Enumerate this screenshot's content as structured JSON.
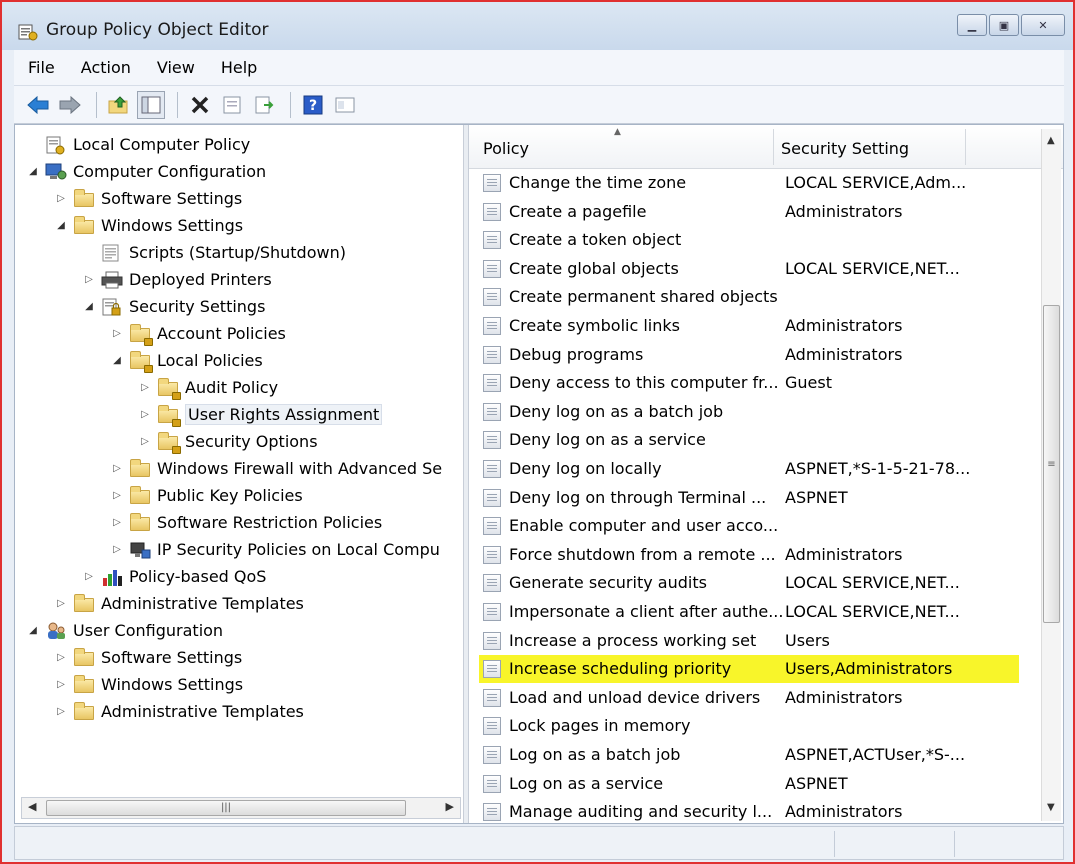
{
  "window": {
    "title": "Group Policy Object Editor"
  },
  "menu": [
    "File",
    "Action",
    "View",
    "Help"
  ],
  "toolbar": [
    "back-icon",
    "forward-icon",
    "up-folder-icon",
    "show-hide-tree-icon",
    "delete-icon",
    "properties-icon",
    "export-list-icon",
    "help-icon",
    "console-icon"
  ],
  "tree": [
    {
      "label": "Local Computer Policy",
      "depth": 0,
      "toggle": "",
      "icon": "policy"
    },
    {
      "label": "Computer Configuration",
      "depth": 0,
      "toggle": "open",
      "icon": "computer"
    },
    {
      "label": "Software Settings",
      "depth": 1,
      "toggle": "closed",
      "icon": "folder"
    },
    {
      "label": "Windows Settings",
      "depth": 1,
      "toggle": "open",
      "icon": "folder"
    },
    {
      "label": "Scripts (Startup/Shutdown)",
      "depth": 2,
      "toggle": "",
      "icon": "script"
    },
    {
      "label": "Deployed Printers",
      "depth": 2,
      "toggle": "closed",
      "icon": "printer"
    },
    {
      "label": "Security Settings",
      "depth": 2,
      "toggle": "open",
      "icon": "security"
    },
    {
      "label": "Account Policies",
      "depth": 3,
      "toggle": "closed",
      "icon": "folder-lock"
    },
    {
      "label": "Local Policies",
      "depth": 3,
      "toggle": "open",
      "icon": "folder-lock"
    },
    {
      "label": "Audit Policy",
      "depth": 4,
      "toggle": "closed",
      "icon": "folder-lock"
    },
    {
      "label": "User Rights Assignment",
      "depth": 4,
      "toggle": "closed",
      "icon": "folder-lock",
      "selected": true
    },
    {
      "label": "Security Options",
      "depth": 4,
      "toggle": "closed",
      "icon": "folder-lock"
    },
    {
      "label": "Windows Firewall with Advanced Se",
      "depth": 3,
      "toggle": "closed",
      "icon": "folder"
    },
    {
      "label": "Public Key Policies",
      "depth": 3,
      "toggle": "closed",
      "icon": "folder"
    },
    {
      "label": "Software Restriction Policies",
      "depth": 3,
      "toggle": "closed",
      "icon": "folder"
    },
    {
      "label": "IP Security Policies on Local Compu",
      "depth": 3,
      "toggle": "closed",
      "icon": "ipsec"
    },
    {
      "label": "Policy-based QoS",
      "depth": 2,
      "toggle": "closed",
      "icon": "qos"
    },
    {
      "label": "Administrative Templates",
      "depth": 1,
      "toggle": "closed",
      "icon": "folder"
    },
    {
      "label": "User Configuration",
      "depth": 0,
      "toggle": "open",
      "icon": "users"
    },
    {
      "label": "Software Settings",
      "depth": 1,
      "toggle": "closed",
      "icon": "folder"
    },
    {
      "label": "Windows Settings",
      "depth": 1,
      "toggle": "closed",
      "icon": "folder"
    },
    {
      "label": "Administrative Templates",
      "depth": 1,
      "toggle": "closed",
      "icon": "folder"
    }
  ],
  "list": {
    "columns": [
      "Policy",
      "Security Setting"
    ],
    "rows": [
      {
        "policy": "Change the time zone",
        "setting": "LOCAL SERVICE,Adm..."
      },
      {
        "policy": "Create a pagefile",
        "setting": "Administrators"
      },
      {
        "policy": "Create a token object",
        "setting": ""
      },
      {
        "policy": "Create global objects",
        "setting": "LOCAL SERVICE,NET..."
      },
      {
        "policy": "Create permanent shared objects",
        "setting": ""
      },
      {
        "policy": "Create symbolic links",
        "setting": "Administrators"
      },
      {
        "policy": "Debug programs",
        "setting": "Administrators"
      },
      {
        "policy": "Deny access to this computer fr...",
        "setting": "Guest"
      },
      {
        "policy": "Deny log on as a batch job",
        "setting": ""
      },
      {
        "policy": "Deny log on as a service",
        "setting": ""
      },
      {
        "policy": "Deny log on locally",
        "setting": "ASPNET,*S-1-5-21-78..."
      },
      {
        "policy": "Deny log on through Terminal ...",
        "setting": "ASPNET"
      },
      {
        "policy": "Enable computer and user acco...",
        "setting": ""
      },
      {
        "policy": "Force shutdown from a remote ...",
        "setting": "Administrators"
      },
      {
        "policy": "Generate security audits",
        "setting": "LOCAL SERVICE,NET..."
      },
      {
        "policy": "Impersonate a client after authe...",
        "setting": "LOCAL SERVICE,NET..."
      },
      {
        "policy": "Increase a process working set",
        "setting": "Users"
      },
      {
        "policy": "Increase scheduling priority",
        "setting": "Users,Administrators",
        "highlighted": true
      },
      {
        "policy": "Load and unload device drivers",
        "setting": "Administrators"
      },
      {
        "policy": "Lock pages in memory",
        "setting": ""
      },
      {
        "policy": "Log on as a batch job",
        "setting": "ASPNET,ACTUser,*S-..."
      },
      {
        "policy": "Log on as a service",
        "setting": "ASPNET"
      },
      {
        "policy": "Manage auditing and security l...",
        "setting": "Administrators"
      }
    ]
  },
  "colors": {
    "highlight": "#f8f52a",
    "selection": "#eef2f7",
    "window_border": "#e03030"
  }
}
